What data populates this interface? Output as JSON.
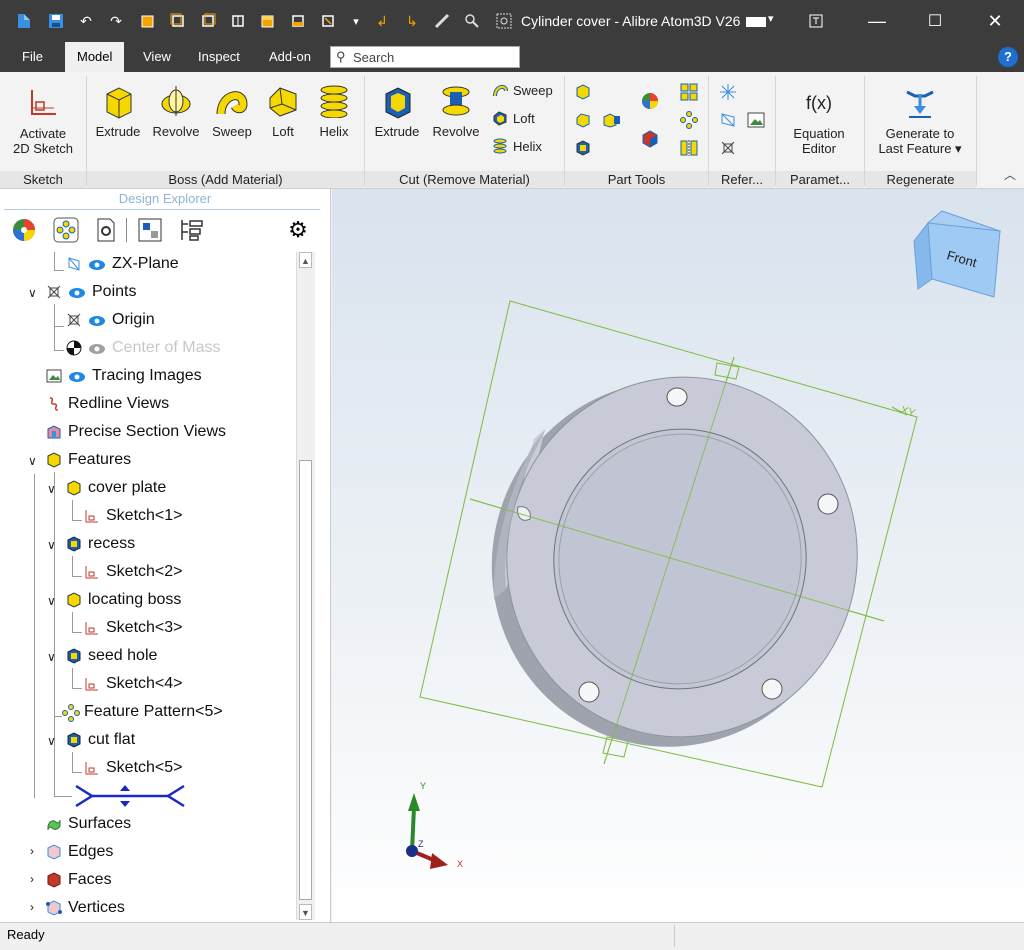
{
  "window": {
    "title": "Cylinder cover - Alibre Atom3D V26",
    "minimize": "—",
    "maximize": "☐",
    "close": "✕"
  },
  "menu_tabs": [
    "File",
    "Model",
    "View",
    "Inspect",
    "Add-on"
  ],
  "active_tab": "Model",
  "search": {
    "placeholder": "Search"
  },
  "ribbon": {
    "activate": {
      "line1": "Activate",
      "line2": "2D Sketch"
    },
    "boss": [
      "Extrude",
      "Revolve",
      "Sweep",
      "Loft",
      "Helix"
    ],
    "cut": [
      "Extrude",
      "Revolve"
    ],
    "cut_small": [
      "Sweep",
      "Loft",
      "Helix"
    ],
    "equation": {
      "line1": "Equation",
      "line2": "Editor"
    },
    "generate": {
      "line1": "Generate to",
      "line2": "Last Feature ▾"
    },
    "group_labels": {
      "sketch": "Sketch",
      "boss": "Boss (Add Material)",
      "cut": "Cut (Remove Material)",
      "part_tools": "Part Tools",
      "refer": "Refer...",
      "param": "Paramet...",
      "regen": "Regenerate"
    },
    "fx": "f(x)"
  },
  "design_explorer": {
    "title": "Design Explorer",
    "items": [
      {
        "label": "ZX-Plane"
      },
      {
        "label": "Points"
      },
      {
        "label": "Origin"
      },
      {
        "label": "Center of Mass"
      },
      {
        "label": "Tracing Images"
      },
      {
        "label": "Redline Views"
      },
      {
        "label": "Precise Section Views"
      },
      {
        "label": "Features"
      },
      {
        "label": "cover plate"
      },
      {
        "label": "Sketch<1>"
      },
      {
        "label": "recess"
      },
      {
        "label": "Sketch<2>"
      },
      {
        "label": "locating boss"
      },
      {
        "label": "Sketch<3>"
      },
      {
        "label": "seed hole"
      },
      {
        "label": "Sketch<4>"
      },
      {
        "label": "Feature Pattern<5>"
      },
      {
        "label": "cut flat"
      },
      {
        "label": "Sketch<5>"
      },
      {
        "label": "Surfaces"
      },
      {
        "label": "Edges"
      },
      {
        "label": "Faces"
      },
      {
        "label": "Vertices"
      }
    ]
  },
  "viewport": {
    "view_cube_label": "Front",
    "plane_label": "XY",
    "triad": {
      "x": "X",
      "y": "Y",
      "z": "Z"
    }
  },
  "status": {
    "text": "Ready"
  },
  "colors": {
    "accent": "#1e6fd0",
    "feature_yellow": "#f5d800",
    "cut_blue": "#1a5fb4",
    "sketch_red": "#c0392b"
  }
}
